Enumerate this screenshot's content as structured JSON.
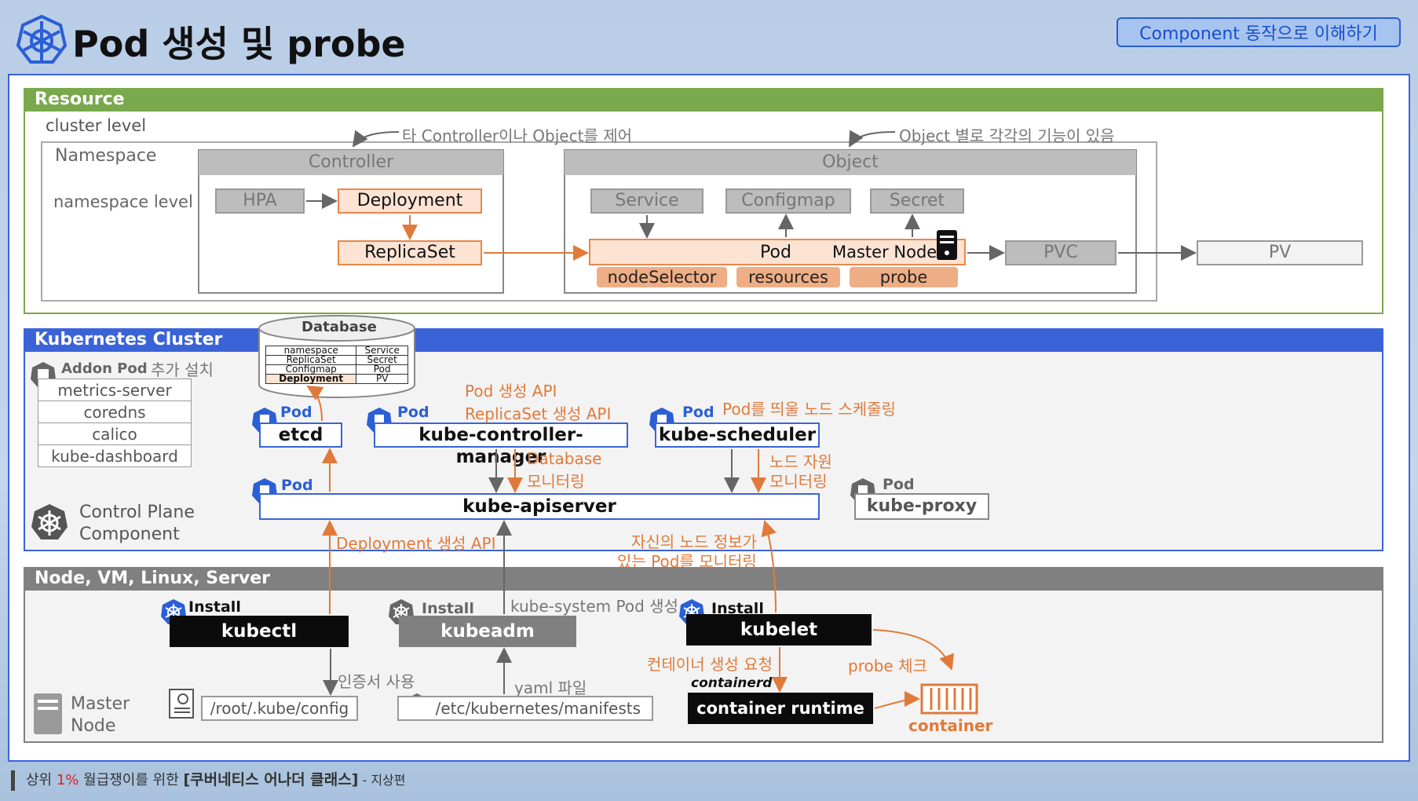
{
  "header": {
    "title": "Pod 생성 및 probe",
    "badge": "Component 동작으로 이해하기"
  },
  "resource": {
    "section_title": "Resource",
    "cluster_level": "cluster level",
    "namespace": "Namespace",
    "namespace_level": "namespace  level",
    "controller_note": "타 Controller이나 Object를 제어",
    "object_note": "Object 별로 각각의 기능이 있음",
    "controller": {
      "title": "Controller",
      "hpa": "HPA",
      "deployment": "Deployment",
      "replicaset": "ReplicaSet"
    },
    "object": {
      "title": "Object",
      "service": "Service",
      "configmap": "Configmap",
      "secret": "Secret",
      "pod": "Pod",
      "master_node": "Master Node",
      "node_selector": "nodeSelector",
      "resources": "resources",
      "probe": "probe"
    },
    "pvc": "PVC",
    "pv": "PV"
  },
  "cluster": {
    "section_title": "Kubernetes Cluster",
    "database": {
      "title": "Database",
      "rows": [
        [
          "namespace",
          "Service"
        ],
        [
          "ReplicaSet",
          "Secret"
        ],
        [
          "Configmap",
          "Pod"
        ],
        [
          "Deployment",
          "PV"
        ]
      ]
    },
    "addon_pod": "Addon Pod",
    "addon_note": "추가 설치",
    "addons": [
      "metrics-server",
      "coredns",
      "calico",
      "kube-dashboard"
    ],
    "control_plane": [
      "Control Plane",
      "Component"
    ],
    "pod_tag": "Pod",
    "etcd": "etcd",
    "controller_manager": "kube-controller-manager",
    "scheduler": "kube-scheduler",
    "apiserver": "kube-apiserver",
    "proxy": "kube-proxy",
    "pod_create_api": "Pod 생성 API",
    "replicaset_create_api": "ReplicaSet 생성 API",
    "schedule_note": "Pod를 띄울 노드 스케줄링",
    "db_monitor": [
      "Database",
      "모니터링"
    ],
    "node_monitor": [
      "노드 자원",
      "모니터링"
    ],
    "deployment_api": "Deployment  생성 API",
    "kubelet_monitor": [
      "자신의 노드 정보가",
      "있는 Pod를 모니터링"
    ]
  },
  "node": {
    "section_title": "Node, VM, Linux, Server",
    "install": "Install",
    "kubectl": "kubectl",
    "kubeadm": "kubeadm",
    "kubelet": "kubelet",
    "kube_system": "kube-system Pod 생성",
    "cert_note": "인증서 사용",
    "yaml_note": "yaml 파일",
    "container_request": "컨테이너 생성 요청",
    "probe_check": "probe 체크",
    "containerd_logo": "containerd",
    "container_runtime": "container runtime",
    "container": "container",
    "kube_config": "/root/.kube/config",
    "manifests": "/etc/kubernetes/manifests",
    "master_node": [
      "Master",
      "Node"
    ]
  },
  "footer": {
    "prefix": "상위 ",
    "percent": "1%",
    "middle": " 월급쟁이를 위한  ",
    "bold": "[쿠버네티스 어나더 클래스]",
    "suffix": "  - 지상편"
  },
  "colors": {
    "accent_blue": "#3b63d8",
    "resource_green": "#7aa84c",
    "orange": "#e07a3a",
    "node_grey": "#808080"
  }
}
